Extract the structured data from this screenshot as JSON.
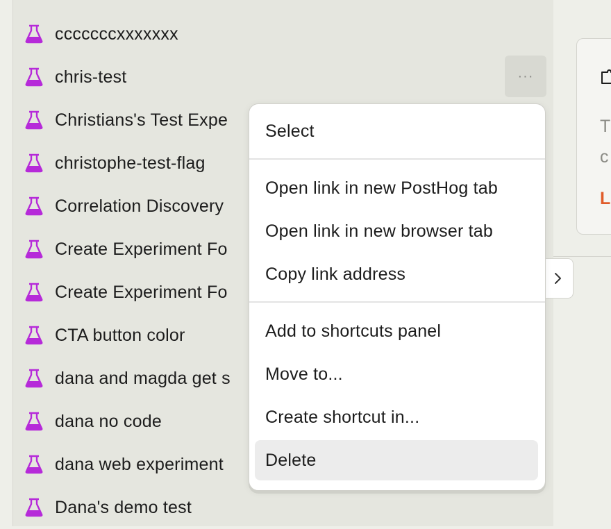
{
  "list": {
    "items": [
      {
        "label": "cccccccxxxxxxx"
      },
      {
        "label": "chris-test"
      },
      {
        "label": "Christians's Test Expe"
      },
      {
        "label": "christophe-test-flag"
      },
      {
        "label": "Correlation Discovery"
      },
      {
        "label": "Create Experiment Fo"
      },
      {
        "label": "Create Experiment Fo"
      },
      {
        "label": "CTA button color"
      },
      {
        "label": "dana and magda get s"
      },
      {
        "label": "dana no code"
      },
      {
        "label": "dana web experiment"
      },
      {
        "label": "Dana's demo test"
      }
    ],
    "more_label": "···",
    "icon_color": "#b62ad9"
  },
  "menu": {
    "items": [
      {
        "label": "Select"
      },
      {
        "label": "Open link in new PostHog tab"
      },
      {
        "label": "Open link in new browser tab"
      },
      {
        "label": "Copy link address"
      },
      {
        "label": "Add to shortcuts panel"
      },
      {
        "label": "Move to..."
      },
      {
        "label": "Create shortcut in..."
      },
      {
        "label": "Delete"
      }
    ]
  },
  "card": {
    "line1": "T",
    "line2": "c",
    "link": "L"
  }
}
